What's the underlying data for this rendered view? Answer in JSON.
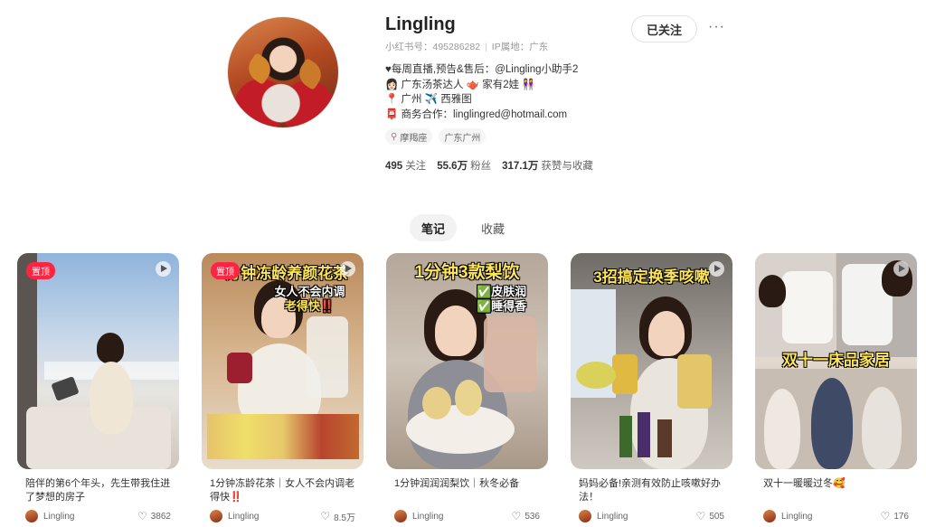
{
  "profile": {
    "name": "Lingling",
    "id_label": "小红书号：495286282",
    "ip_label": "IP属地：广东",
    "follow_button": "已关注",
    "more": "···",
    "bio": [
      "♥每周直播,预告&售后：@Lingling小助手2",
      "👩🏻 广东汤茶达人 🫖 家有2娃 👭",
      "📍 广州 ✈️ 西雅图",
      "📮 商务合作：linglingred@hotmail.com"
    ],
    "tags": [
      "摩羯座",
      "广东广州"
    ],
    "stats": [
      {
        "value": "495",
        "label": "关注"
      },
      {
        "value": "55.6万",
        "label": "粉丝"
      },
      {
        "value": "317.1万",
        "label": "获赞与收藏"
      }
    ]
  },
  "tabs": [
    {
      "label": "笔记",
      "active": true
    },
    {
      "label": "收藏",
      "active": false
    }
  ],
  "notes": [
    {
      "title": "陪伴的第6个年头，先生带我住进了梦想的房子",
      "author": "Lingling",
      "likes": "3862",
      "pinned": "置顶",
      "overlay": "",
      "overlay2": "",
      "overlay3": ""
    },
    {
      "title": "1分钟冻龄花茶｜女人不会内调老得快‼️",
      "author": "Lingling",
      "likes": "8.5万",
      "pinned": "置顶",
      "overlay": "1分钟冻龄养颜花茶",
      "overlay2": "女人不会内调",
      "overlay3": "老得快‼️"
    },
    {
      "title": "1分钟润润润梨饮｜秋冬必备",
      "author": "Lingling",
      "likes": "536",
      "pinned": "",
      "overlay": "1分钟3款梨饮",
      "overlay2": "✅皮肤润",
      "overlay3": "✅睡得香"
    },
    {
      "title": "妈妈必备!亲测有效防止咳嗽好办法！",
      "author": "Lingling",
      "likes": "505",
      "pinned": "",
      "overlay": "3招搞定换季咳嗽",
      "overlay2": "",
      "overlay3": ""
    },
    {
      "title": "双十一暖暖过冬🥰",
      "author": "Lingling",
      "likes": "176",
      "pinned": "",
      "overlay": "双十一床品家居",
      "overlay2": "",
      "overlay3": ""
    }
  ]
}
